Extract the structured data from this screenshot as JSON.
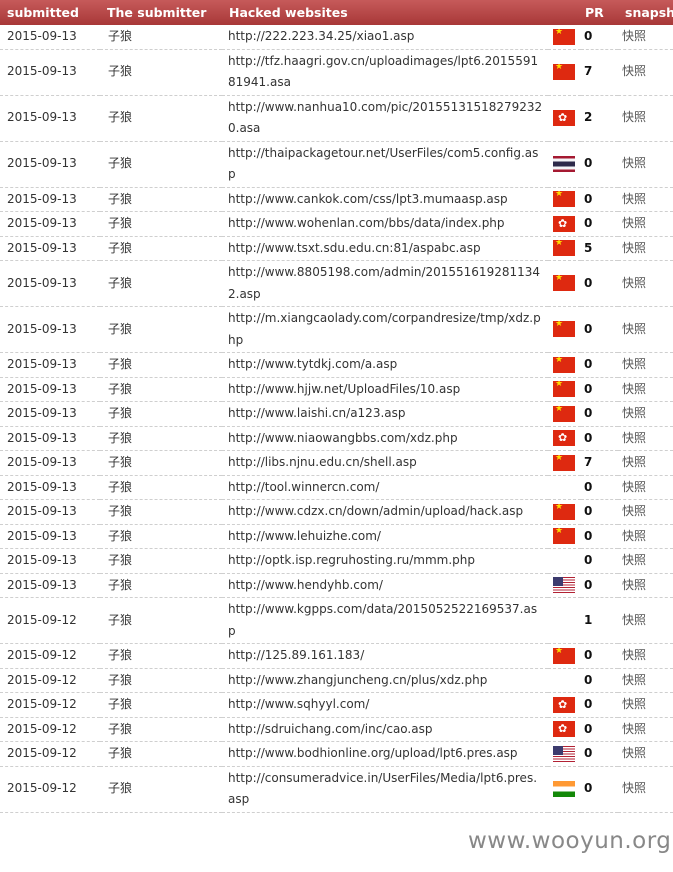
{
  "headers": [
    "submitted",
    "The submitter",
    "Hacked websites",
    "",
    "PR",
    "snapsho"
  ],
  "rows": [
    {
      "date": "2015-09-13",
      "submitter": "子狼",
      "url": "http://222.223.34.25/xiao1.asp",
      "flag": "cn",
      "pr": "0",
      "snapshot": "快照"
    },
    {
      "date": "2015-09-13",
      "submitter": "子狼",
      "url": "http://tfz.haagri.gov.cn/uploadimages/lpt6.201559181941.asa",
      "flag": "cn",
      "pr": "7",
      "snapshot": "快照"
    },
    {
      "date": "2015-09-13",
      "submitter": "子狼",
      "url": "http://www.nanhua10.com/pic/201551315182792320.asa",
      "flag": "hk",
      "pr": "2",
      "snapshot": "快照"
    },
    {
      "date": "2015-09-13",
      "submitter": "子狼",
      "url": "http://thaipackagetour.net/UserFiles/com5.config.asp",
      "flag": "th",
      "pr": "0",
      "snapshot": "快照"
    },
    {
      "date": "2015-09-13",
      "submitter": "子狼",
      "url": "http://www.cankok.com/css/lpt3.mumaasp.asp",
      "flag": "cn",
      "pr": "0",
      "snapshot": "快照"
    },
    {
      "date": "2015-09-13",
      "submitter": "子狼",
      "url": "http://www.wohenlan.com/bbs/data/index.php",
      "flag": "hk",
      "pr": "0",
      "snapshot": "快照"
    },
    {
      "date": "2015-09-13",
      "submitter": "子狼",
      "url": "http://www.tsxt.sdu.edu.cn:81/aspabc.asp",
      "flag": "cn",
      "pr": "5",
      "snapshot": "快照"
    },
    {
      "date": "2015-09-13",
      "submitter": "子狼",
      "url": "http://www.8805198.com/admin/2015516192811342.asp",
      "flag": "cn",
      "pr": "0",
      "snapshot": "快照"
    },
    {
      "date": "2015-09-13",
      "submitter": "子狼",
      "url": "http://m.xiangcaolady.com/corpandresize/tmp/xdz.php",
      "flag": "cn",
      "pr": "0",
      "snapshot": "快照"
    },
    {
      "date": "2015-09-13",
      "submitter": "子狼",
      "url": "http://www.tytdkj.com/a.asp",
      "flag": "cn",
      "pr": "0",
      "snapshot": "快照"
    },
    {
      "date": "2015-09-13",
      "submitter": "子狼",
      "url": "http://www.hjjw.net/UploadFiles/10.asp",
      "flag": "cn",
      "pr": "0",
      "snapshot": "快照"
    },
    {
      "date": "2015-09-13",
      "submitter": "子狼",
      "url": "http://www.laishi.cn/a123.asp",
      "flag": "cn",
      "pr": "0",
      "snapshot": "快照"
    },
    {
      "date": "2015-09-13",
      "submitter": "子狼",
      "url": "http://www.niaowangbbs.com/xdz.php",
      "flag": "hk",
      "pr": "0",
      "snapshot": "快照"
    },
    {
      "date": "2015-09-13",
      "submitter": "子狼",
      "url": "http://libs.njnu.edu.cn/shell.asp",
      "flag": "cn",
      "pr": "7",
      "snapshot": "快照"
    },
    {
      "date": "2015-09-13",
      "submitter": "子狼",
      "url": "http://tool.winnercn.com/",
      "flag": "",
      "pr": "0",
      "snapshot": "快照"
    },
    {
      "date": "2015-09-13",
      "submitter": "子狼",
      "url": "http://www.cdzx.cn/down/admin/upload/hack.asp",
      "flag": "cn",
      "pr": "0",
      "snapshot": "快照"
    },
    {
      "date": "2015-09-13",
      "submitter": "子狼",
      "url": "http://www.lehuizhe.com/",
      "flag": "cn",
      "pr": "0",
      "snapshot": "快照"
    },
    {
      "date": "2015-09-13",
      "submitter": "子狼",
      "url": "http://optk.isp.regruhosting.ru/mmm.php",
      "flag": "",
      "pr": "0",
      "snapshot": "快照"
    },
    {
      "date": "2015-09-13",
      "submitter": "子狼",
      "url": "http://www.hendyhb.com/",
      "flag": "us",
      "pr": "0",
      "snapshot": "快照"
    },
    {
      "date": "2015-09-12",
      "submitter": "子狼",
      "url": "http://www.kgpps.com/data/2015052522169537.asp",
      "flag": "",
      "pr": "1",
      "snapshot": "快照"
    },
    {
      "date": "2015-09-12",
      "submitter": "子狼",
      "url": "http://125.89.161.183/",
      "flag": "cn",
      "pr": "0",
      "snapshot": "快照"
    },
    {
      "date": "2015-09-12",
      "submitter": "子狼",
      "url": "http://www.zhangjuncheng.cn/plus/xdz.php",
      "flag": "",
      "pr": "0",
      "snapshot": "快照"
    },
    {
      "date": "2015-09-12",
      "submitter": "子狼",
      "url": "http://www.sqhyyl.com/",
      "flag": "hk",
      "pr": "0",
      "snapshot": "快照"
    },
    {
      "date": "2015-09-12",
      "submitter": "子狼",
      "url": "http://sdruichang.com/inc/cao.asp",
      "flag": "hk",
      "pr": "0",
      "snapshot": "快照"
    },
    {
      "date": "2015-09-12",
      "submitter": "子狼",
      "url": "http://www.bodhionline.org/upload/lpt6.pres.asp",
      "flag": "us",
      "pr": "0",
      "snapshot": "快照"
    },
    {
      "date": "2015-09-12",
      "submitter": "子狼",
      "url": "http://consumeradvice.in/UserFiles/Media/lpt6.pres.asp",
      "flag": "in",
      "pr": "0",
      "snapshot": "快照"
    }
  ],
  "watermark": "www.wooyun.org"
}
